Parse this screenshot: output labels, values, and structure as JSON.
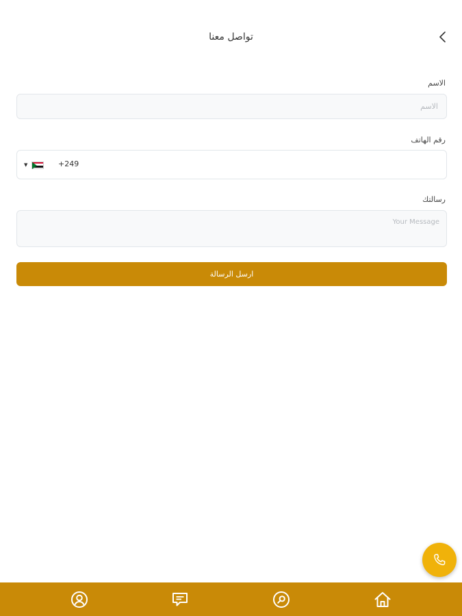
{
  "header": {
    "title": "تواصل معنا",
    "back_icon": "chevron-left-icon"
  },
  "form": {
    "name_label": "الاسم",
    "name_placeholder": "الاسم",
    "name_value": "",
    "phone_label": "رقم الهاتف",
    "country_flag": "sudan-flag-icon",
    "dial_code": "+249",
    "phone_value": "",
    "message_label": "رسالتك",
    "message_placeholder": "Your Message",
    "message_value": "",
    "submit_label": "ارسل الرسالة"
  },
  "fab": {
    "icon": "phone-icon"
  },
  "bottom_nav": {
    "items": [
      {
        "icon": "user-profile-icon"
      },
      {
        "icon": "chat-icon"
      },
      {
        "icon": "search-icon"
      },
      {
        "icon": "home-icon"
      }
    ]
  },
  "colors": {
    "accent": "#c98a07",
    "fab": "#f0b20a",
    "input_border": "#e2e6ea",
    "input_bg": "#f8f9fa"
  }
}
